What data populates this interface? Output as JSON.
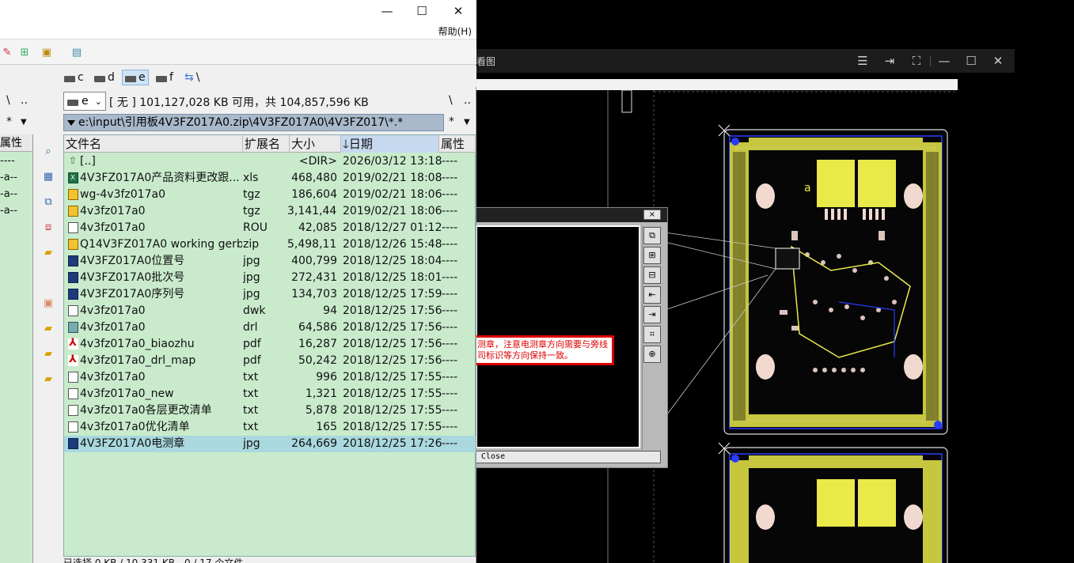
{
  "viewer": {
    "title": "看图",
    "buttons": [
      "menu-icon",
      "pin-icon",
      "fullscreen-icon",
      "minimize-icon",
      "maximize-icon",
      "close-icon"
    ]
  },
  "dialog": {
    "close_label": "×",
    "footer_close": "Close"
  },
  "warning": {
    "text": "测章，注意电测章方向需要与旁线司标识等方向保持一致。"
  },
  "filemanager": {
    "window_buttons": {
      "minimize": "—",
      "maximize": "☐",
      "close": "✕"
    },
    "menu_help": "帮助(H)",
    "drives": [
      {
        "label": "c"
      },
      {
        "label": "d"
      },
      {
        "label": "e",
        "selected": true
      },
      {
        "label": "f"
      },
      {
        "label": "\\"
      }
    ],
    "drive_combo": "e",
    "free_info": "[ 无 ]  101,127,028 KB 可用，共 104,857,596 KB",
    "nav_root": "\\",
    "nav_up": "..",
    "left_nav_root": "\\",
    "left_nav_up": "..",
    "path": "e:\\input\\引用板4V3FZ017A0.zip\\4V3FZ017A0\\4V3FZ017\\*.*",
    "filter": "*",
    "left_filter": "*",
    "columns": {
      "name": "文件名",
      "ext": "扩展名",
      "size": "大小",
      "date": "日期",
      "attr": "属性"
    },
    "left_pane": {
      "header": "属性",
      "rows": [
        "----",
        "-a--",
        "-a--",
        "-a--"
      ]
    },
    "files": [
      {
        "icon": "up",
        "name": "[..]",
        "ext": "",
        "size": "<DIR>",
        "date": "2026/03/12 13:18",
        "attr": "----"
      },
      {
        "icon": "xls",
        "name": "4V3FZ017A0产品资料更改跟...",
        "ext": "xls",
        "size": "468,480",
        "date": "2019/02/21 18:08",
        "attr": "----"
      },
      {
        "icon": "zip",
        "name": "wg-4v3fz017a0",
        "ext": "tgz",
        "size": "186,604",
        "date": "2019/02/21 18:06",
        "attr": "----"
      },
      {
        "icon": "zip",
        "name": "4v3fz017a0",
        "ext": "tgz",
        "size": "3,141,442",
        "date": "2019/02/21 18:06",
        "attr": "----"
      },
      {
        "icon": "txt",
        "name": "4v3fz017a0",
        "ext": "ROU",
        "size": "42,085",
        "date": "2018/12/27 01:12",
        "attr": "----"
      },
      {
        "icon": "zip",
        "name": "Q14V3FZ017A0 working gerb...",
        "ext": "zip",
        "size": "5,498,116",
        "date": "2018/12/26 15:48",
        "attr": "----"
      },
      {
        "icon": "jpg",
        "name": "4V3FZ017A0位置号",
        "ext": "jpg",
        "size": "400,799",
        "date": "2018/12/25 18:04",
        "attr": "----"
      },
      {
        "icon": "jpg",
        "name": "4V3FZ017A0批次号",
        "ext": "jpg",
        "size": "272,431",
        "date": "2018/12/25 18:01",
        "attr": "----"
      },
      {
        "icon": "jpg",
        "name": "4V3FZ017A0序列号",
        "ext": "jpg",
        "size": "134,703",
        "date": "2018/12/25 17:59",
        "attr": "----"
      },
      {
        "icon": "txt",
        "name": "4v3fz017a0",
        "ext": "dwk",
        "size": "94",
        "date": "2018/12/25 17:56",
        "attr": "----"
      },
      {
        "icon": "drl",
        "name": "4v3fz017a0",
        "ext": "drl",
        "size": "64,586",
        "date": "2018/12/25 17:56",
        "attr": "----"
      },
      {
        "icon": "pdf",
        "name": "4v3fz017a0_biaozhu",
        "ext": "pdf",
        "size": "16,287",
        "date": "2018/12/25 17:56",
        "attr": "----"
      },
      {
        "icon": "pdf",
        "name": "4v3fz017a0_drl_map",
        "ext": "pdf",
        "size": "50,242",
        "date": "2018/12/25 17:56",
        "attr": "----"
      },
      {
        "icon": "txt",
        "name": "4v3fz017a0",
        "ext": "txt",
        "size": "996",
        "date": "2018/12/25 17:55",
        "attr": "----"
      },
      {
        "icon": "txt",
        "name": "4v3fz017a0_new",
        "ext": "txt",
        "size": "1,321",
        "date": "2018/12/25 17:55",
        "attr": "----"
      },
      {
        "icon": "txt",
        "name": "4v3fz017a0各层更改清单",
        "ext": "txt",
        "size": "5,878",
        "date": "2018/12/25 17:55",
        "attr": "----"
      },
      {
        "icon": "txt",
        "name": "4v3fz017a0优化清单",
        "ext": "txt",
        "size": "165",
        "date": "2018/12/25 17:55",
        "attr": "----"
      },
      {
        "icon": "jpg",
        "name": "4V3FZ017A0电测章",
        "ext": "jpg",
        "size": "264,669",
        "date": "2018/12/25 17:26",
        "attr": "----",
        "selected": true
      }
    ],
    "status": "已选择 0 KB / 10,331 KB，0 / 17 个文件"
  },
  "colors": {
    "list_bg": "#c9ebcc",
    "selected_row": "#a9d8de",
    "path_bar": "#a9b9cc",
    "pcb_yellow": "#e9e94a",
    "pcb_blue": "#2a3cff"
  }
}
